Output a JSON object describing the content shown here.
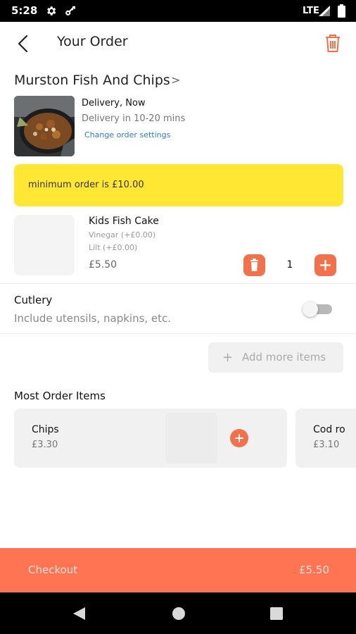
{
  "status_bar": {
    "time": "5:28",
    "network": "LTE"
  },
  "header": {
    "title": "Your Order"
  },
  "restaurant": {
    "name": "Murston Fish And Chips",
    "chevron": ">",
    "delivery_mode": "Delivery, Now",
    "delivery_time": "Delivery in 10-20 mins",
    "change_settings": "Change order settings"
  },
  "banner": {
    "text": "minimum order is £10.00"
  },
  "order_item": {
    "name": "Kids Fish Cake",
    "options": [
      "Vinegar (+£0.00)",
      "Lilt (+£0.00)"
    ],
    "price": "£5.50",
    "quantity": "1"
  },
  "cutlery": {
    "title": "Cutlery",
    "subtitle": "Include utensils, napkins, etc.",
    "enabled": false
  },
  "add_more": {
    "plus": "+",
    "label": "Add more items"
  },
  "most_ordered": {
    "title": "Most Order Items",
    "items": [
      {
        "name": "Chips",
        "price": "£3.30"
      },
      {
        "name": "Cod ro",
        "price": "£3.10"
      }
    ]
  },
  "checkout": {
    "label": "Checkout",
    "total": "£5.50"
  },
  "colors": {
    "accent": "#f2704a",
    "checkout_bg": "#ff7452",
    "banner_bg": "#ffe733",
    "link": "#2e7bd6"
  }
}
